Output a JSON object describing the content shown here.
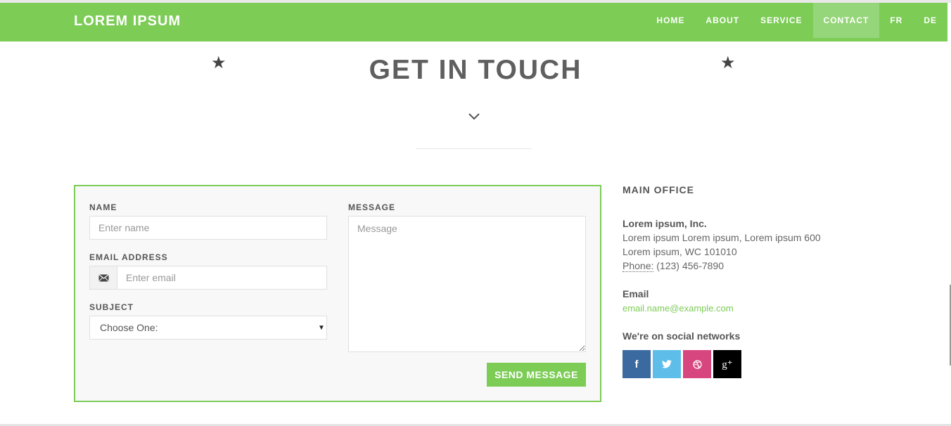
{
  "navbar": {
    "brand": "LOREM IPSUM",
    "items": [
      {
        "label": "HOME",
        "active": false
      },
      {
        "label": "ABOUT",
        "active": false
      },
      {
        "label": "SERVICE",
        "active": false
      },
      {
        "label": "CONTACT",
        "active": true
      },
      {
        "label": "FR",
        "active": false
      },
      {
        "label": "DE",
        "active": false
      }
    ]
  },
  "section": {
    "title": "GET IN TOUCH",
    "star_glyph": "★",
    "chevron_icon": "chevron-down-icon"
  },
  "form": {
    "name_label": "NAME",
    "name_placeholder": "Enter name",
    "email_label": "EMAIL ADDRESS",
    "email_placeholder": "Enter email",
    "email_icon": "envelope-icon",
    "subject_label": "SUBJECT",
    "subject_selected": "Choose One:",
    "message_label": "MESSAGE",
    "message_placeholder": "Message",
    "send_label": "SEND MESSAGE"
  },
  "office": {
    "title": "MAIN OFFICE",
    "company": "Lorem ipsum, Inc.",
    "address_line1": "Lorem ipsum Lorem ipsum, Lorem ipsum 600",
    "address_line2": "Lorem ipsum, WC 101010",
    "phone_label": "Phone:",
    "phone_value": "(123) 456-7890",
    "email_heading": "Email",
    "email_value": "email.name@example.com",
    "social_heading": "We're on social networks",
    "social": [
      {
        "icon": "facebook-icon",
        "glyph": "f",
        "color": "#3b6aa0"
      },
      {
        "icon": "twitter-icon",
        "glyph": "t",
        "color": "#5ebde9"
      },
      {
        "icon": "dribbble-icon",
        "glyph": "",
        "color": "#d7467e"
      },
      {
        "icon": "google-plus-icon",
        "glyph": "g⁺",
        "color": "#000000"
      }
    ]
  },
  "colors": {
    "accent": "#7ccc56",
    "nav_active": "#96d67a",
    "form_bg": "#f8f8f8",
    "heading": "#5f5f5f"
  }
}
